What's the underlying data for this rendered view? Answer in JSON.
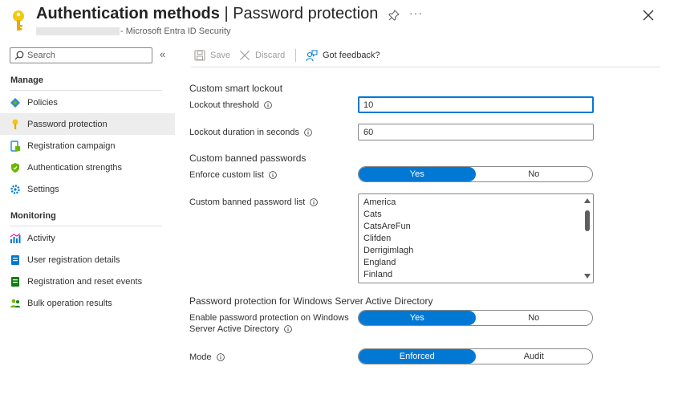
{
  "header": {
    "title_main": "Authentication methods",
    "title_sep": " | ",
    "title_sub": "Password protection",
    "subtitle": "- Microsoft Entra ID Security",
    "more": "···"
  },
  "sidebar": {
    "search_placeholder": "Search",
    "collapse": "«",
    "sections": {
      "manage": "Manage",
      "monitoring": "Monitoring"
    },
    "manage_items": [
      {
        "label": "Policies",
        "icon": "policies-icon"
      },
      {
        "label": "Password protection",
        "icon": "key-icon"
      },
      {
        "label": "Registration campaign",
        "icon": "registration-campaign-icon"
      },
      {
        "label": "Authentication strengths",
        "icon": "shield-icon"
      },
      {
        "label": "Settings",
        "icon": "gear-icon"
      }
    ],
    "monitoring_items": [
      {
        "label": "Activity",
        "icon": "activity-chart-icon"
      },
      {
        "label": "User registration details",
        "icon": "user-details-icon"
      },
      {
        "label": "Registration and reset events",
        "icon": "events-icon"
      },
      {
        "label": "Bulk operation results",
        "icon": "bulk-users-icon"
      }
    ],
    "active": "Password protection"
  },
  "toolbar": {
    "save": "Save",
    "discard": "Discard",
    "feedback": "Got feedback?"
  },
  "form": {
    "lockout_heading": "Custom smart lockout",
    "lockout_threshold_label": "Lockout threshold",
    "lockout_threshold_value": "10",
    "lockout_duration_label": "Lockout duration in seconds",
    "lockout_duration_value": "60",
    "banned_heading": "Custom banned passwords",
    "enforce_label": "Enforce custom list",
    "enforce_options": [
      "Yes",
      "No"
    ],
    "enforce_selected": "Yes",
    "banned_list_label": "Custom banned password list",
    "banned_list": [
      "America",
      "Cats",
      "CatsAreFun",
      "Clifden",
      "Derrigimlagh",
      "England",
      "Finland"
    ],
    "windows_heading": "Password protection for Windows Server Active Directory",
    "enable_label_1": "Enable password protection on Windows",
    "enable_label_2": "Server Active Directory",
    "enable_options": [
      "Yes",
      "No"
    ],
    "enable_selected": "Yes",
    "mode_label": "Mode",
    "mode_options": [
      "Enforced",
      "Audit"
    ],
    "mode_selected": "Enforced"
  },
  "colors": {
    "accent": "#0078d4",
    "key_yellow": "#f2c811",
    "text": "#323130",
    "disabled": "#a19f9d"
  }
}
